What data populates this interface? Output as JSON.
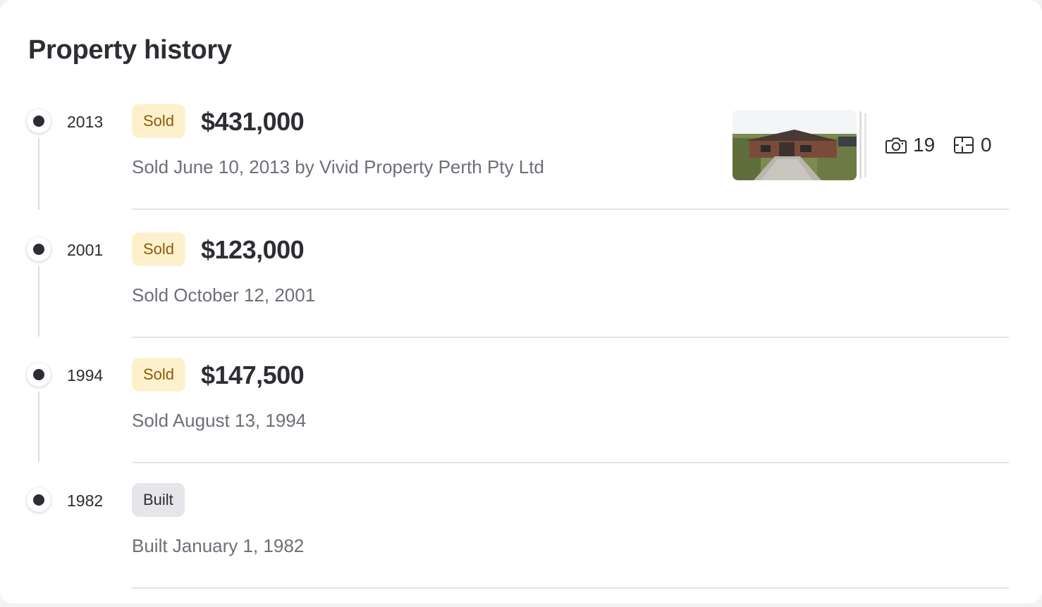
{
  "section": {
    "title": "Property history"
  },
  "history": [
    {
      "year": "2013",
      "badge": "Sold",
      "price": "$431,000",
      "description": "Sold June 10, 2013 by Vivid Property Perth Pty Ltd",
      "media": {
        "photo_count": "19",
        "floorplan_count": "0"
      }
    },
    {
      "year": "2001",
      "badge": "Sold",
      "price": "$123,000",
      "description": "Sold October 12, 2001"
    },
    {
      "year": "1994",
      "badge": "Sold",
      "price": "$147,500",
      "description": "Sold August 13, 1994"
    },
    {
      "year": "1982",
      "badge": "Built",
      "description": "Built January 1, 1982"
    }
  ],
  "icons": {
    "timeline_marker": "timeline-dot-icon",
    "photos": "camera-icon",
    "floorplans": "floorplan-icon"
  },
  "colors": {
    "sold_badge_bg": "#fdf1cd",
    "sold_badge_text": "#8a5b08",
    "built_badge_bg": "#e6e6ea",
    "text_primary": "#2d2d33",
    "text_secondary": "#6e6e78"
  }
}
